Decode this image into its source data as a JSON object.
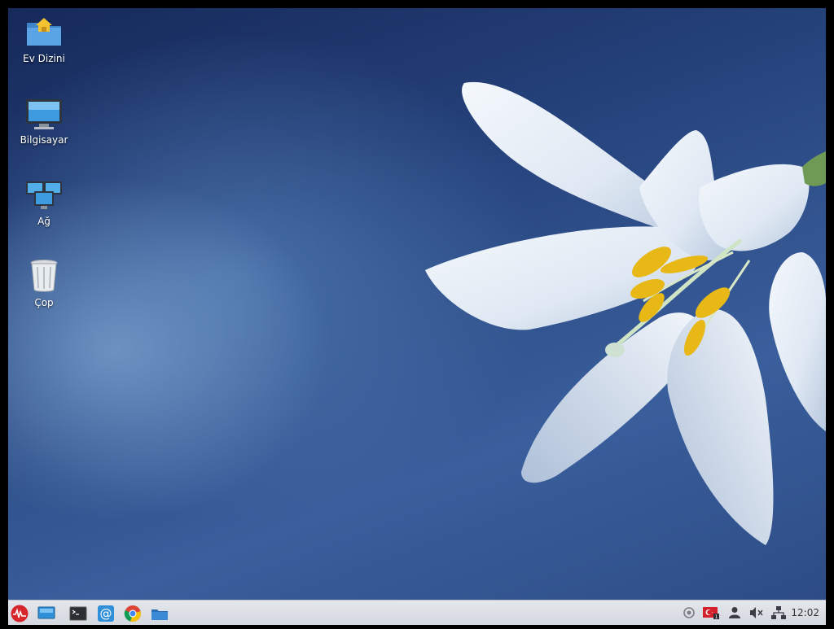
{
  "desktop": {
    "icons": [
      {
        "label": "Ev Dizini",
        "icon": "home-folder-icon"
      },
      {
        "label": "Bilgisayar",
        "icon": "computer-icon"
      },
      {
        "label": "Ağ",
        "icon": "network-icon"
      },
      {
        "label": "Çop",
        "icon": "trash-icon"
      }
    ]
  },
  "taskbar": {
    "launchers": [
      {
        "icon": "app-menu-icon"
      },
      {
        "icon": "show-desktop-icon"
      },
      {
        "icon": "terminal-icon"
      },
      {
        "icon": "mail-icon"
      },
      {
        "icon": "chrome-icon"
      },
      {
        "icon": "file-manager-icon"
      }
    ],
    "tray": [
      {
        "icon": "update-notifier-icon"
      },
      {
        "icon": "keyboard-layout-icon"
      },
      {
        "icon": "user-icon"
      },
      {
        "icon": "volume-muted-icon"
      },
      {
        "icon": "network-status-icon"
      }
    ],
    "clock": "12:02"
  },
  "colors": {
    "taskbar_bg": "#dadee4",
    "wallpaper_dark": "#16295a",
    "wallpaper_light": "#8fb5dc"
  }
}
